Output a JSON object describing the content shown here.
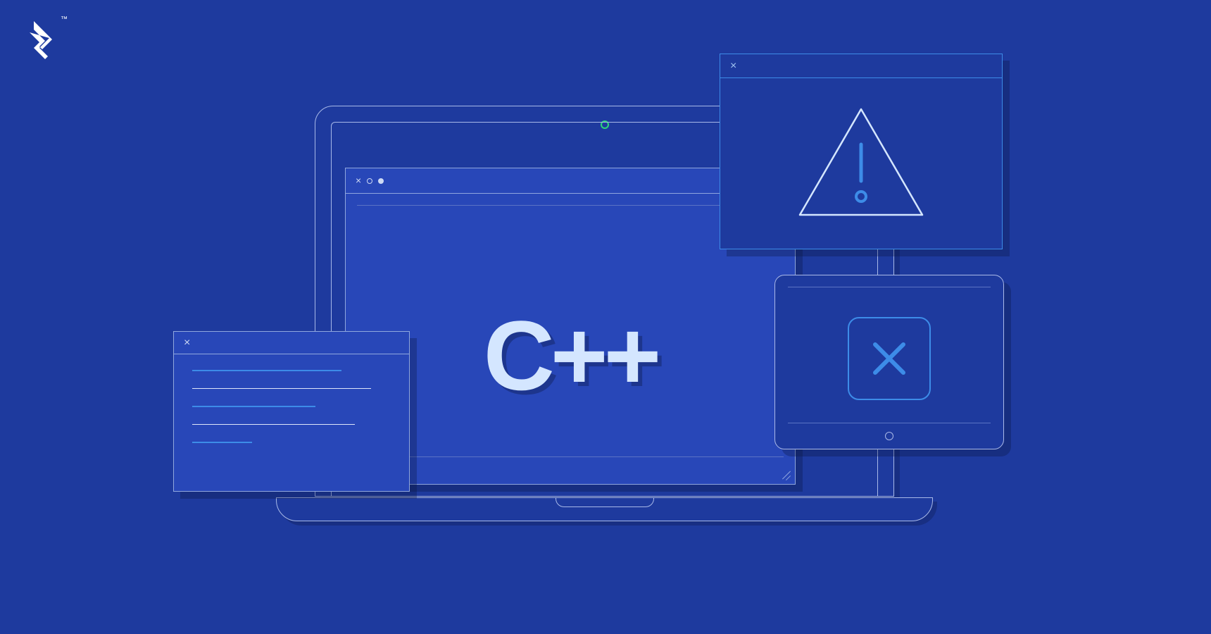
{
  "brand": {
    "name": "Toptal",
    "trademark": "™"
  },
  "main": {
    "language_label": "C++"
  },
  "icons": {
    "warning": "warning-triangle",
    "error": "close-x"
  },
  "colors": {
    "background": "#1e3a9e",
    "panel": "#2847b8",
    "accent_cyan": "#3d8ce8",
    "stroke_light": "#a8b9e8",
    "text_light": "#d4e6ff"
  }
}
